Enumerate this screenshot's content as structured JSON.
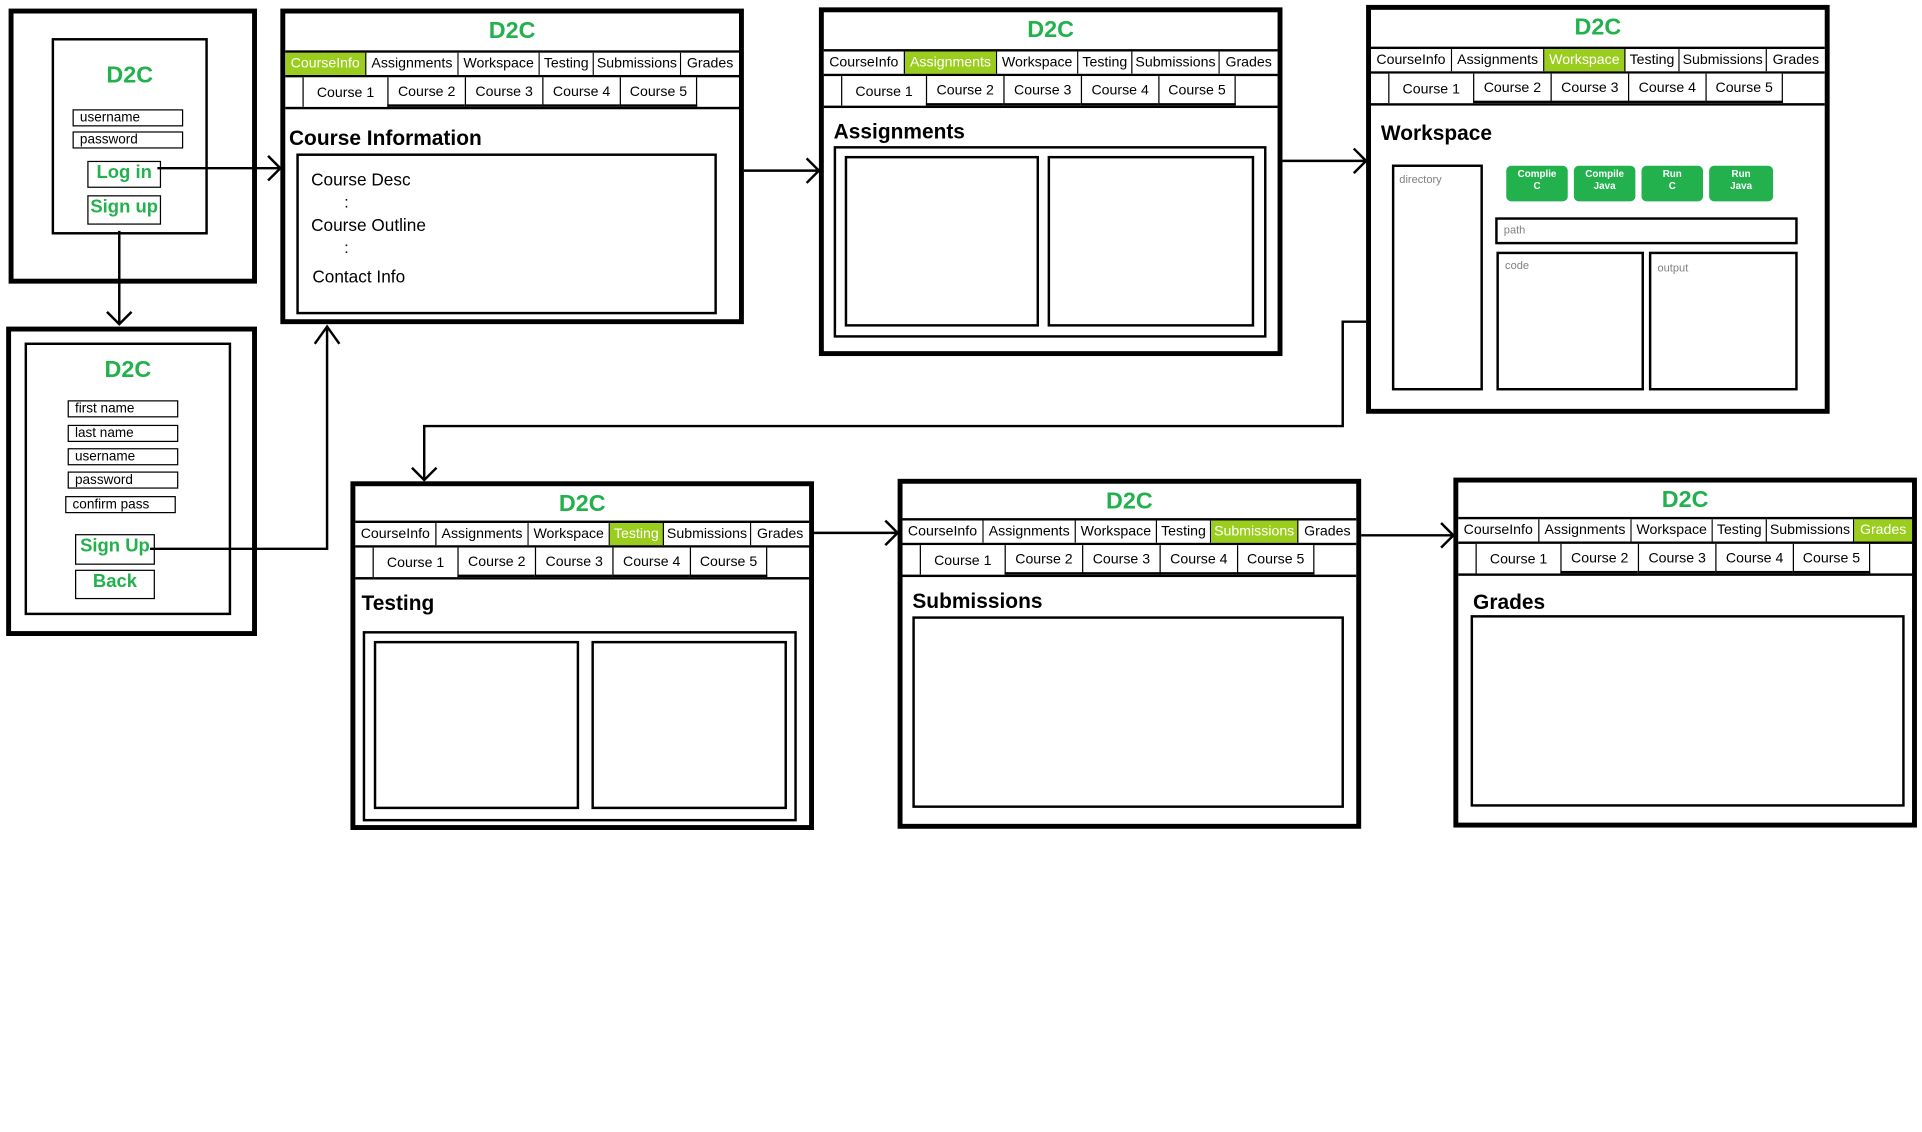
{
  "brand": "D2C",
  "colors": {
    "brand_green": "#22b14c",
    "active_tab": "#9acd1e"
  },
  "nav_tabs": [
    "CourseInfo",
    "Assignments",
    "Workspace",
    "Testing",
    "Submissions",
    "Grades"
  ],
  "course_tabs": [
    "Course 1",
    "Course 2",
    "Course 3",
    "Course 4",
    "Course 5"
  ],
  "login": {
    "username": "username",
    "password": "password",
    "login_button": "Log in",
    "signup_button": "Sign up"
  },
  "signup": {
    "first_name": "first name",
    "last_name": "last name",
    "username": "username",
    "password": "password",
    "confirm_pass": "confirm pass",
    "signup_button": "Sign Up",
    "back_button": "Back"
  },
  "courseinfo": {
    "heading": "Course Information",
    "course_desc": "Course Desc",
    "dots1": ":",
    "course_outline": "Course Outline",
    "dots2": ":",
    "contact_info": "Contact Info"
  },
  "assignments": {
    "heading": "Assignments"
  },
  "workspace": {
    "heading": "Workspace",
    "directory": "directory",
    "path": "path",
    "code": "code",
    "output": "output",
    "compile_c": [
      "Complie",
      "C"
    ],
    "compile_java": [
      "Compile",
      "Java"
    ],
    "run_c": [
      "Run",
      "C"
    ],
    "run_java": [
      "Run",
      "Java"
    ]
  },
  "testing": {
    "heading": "Testing"
  },
  "submissions": {
    "heading": "Submissions"
  },
  "grades": {
    "heading": "Grades"
  }
}
